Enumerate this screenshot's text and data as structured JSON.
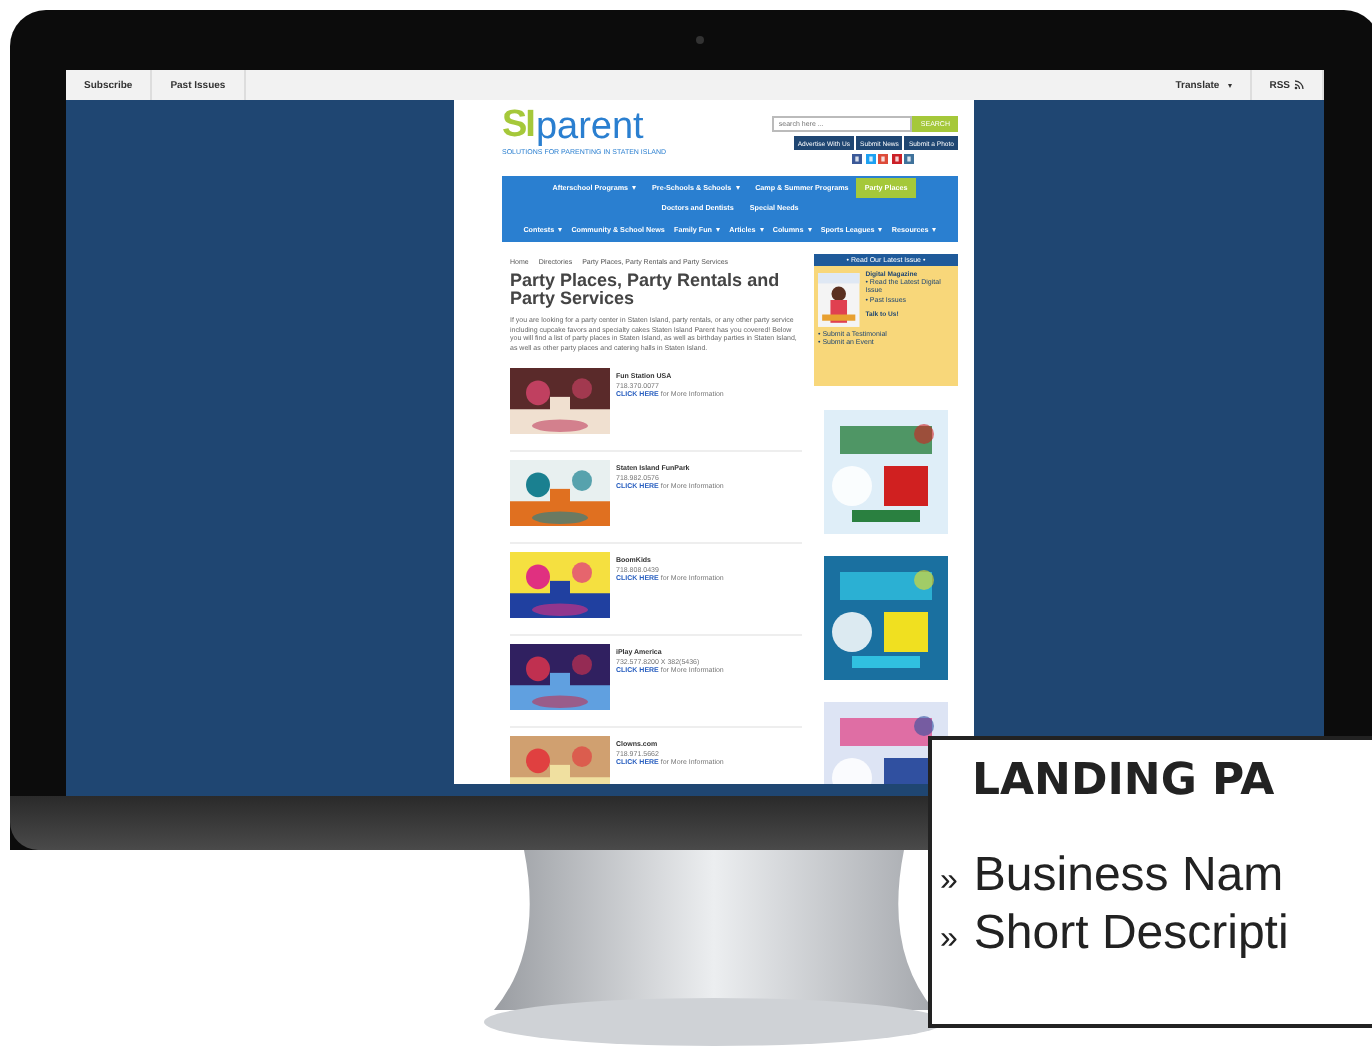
{
  "top_bar": {
    "left_links": [
      "Subscribe",
      "Past Issues"
    ],
    "right_links": [
      {
        "label": "Translate",
        "dropdown": true,
        "icon": false
      },
      {
        "label": "RSS",
        "dropdown": false,
        "icon": true
      }
    ]
  },
  "logo": {
    "mark": "SI",
    "word": "parent",
    "tagline": "SOLUTIONS FOR PARENTING IN STATEN ISLAND"
  },
  "search": {
    "placeholder": "search here ...",
    "button": "SEARCH"
  },
  "header_buttons": [
    "Advertise With Us",
    "Submit News",
    "Submit a Photo"
  ],
  "nav_primary": [
    {
      "label": "Afterschool Programs",
      "dropdown": true,
      "selected": false
    },
    {
      "label": "Pre-Schools & Schools",
      "dropdown": true,
      "selected": false
    },
    {
      "label": "Camp & Summer Programs",
      "dropdown": false,
      "selected": false
    },
    {
      "label": "Party Places",
      "dropdown": false,
      "selected": true
    },
    {
      "label": "Doctors and Dentists",
      "dropdown": false,
      "selected": false
    },
    {
      "label": "Special Needs",
      "dropdown": false,
      "selected": false
    }
  ],
  "nav_secondary": [
    {
      "label": "Contests",
      "dropdown": true
    },
    {
      "label": "Community & School News",
      "dropdown": false
    },
    {
      "label": "Family Fun",
      "dropdown": true
    },
    {
      "label": "Articles",
      "dropdown": true
    },
    {
      "label": "Columns",
      "dropdown": true
    },
    {
      "label": "Sports Leagues",
      "dropdown": true
    },
    {
      "label": "Resources",
      "dropdown": true
    }
  ],
  "breadcrumb": [
    "Home",
    "Directories",
    "Party Places, Party Rentals and Party Services"
  ],
  "title": "Party Places, Party Rentals and Party Services",
  "intro": "If you are looking for a party center in Staten Island, party rentals, or any other party service including cupcake favors and specialty cakes Staten Island Parent has you covered! Below you will find a list of party places in Staten Island, as well as birthday parties in Staten Island, as well as other party places and catering halls in Staten Island.",
  "listings": [
    {
      "name": "Fun Station USA",
      "phone": "718.370.0077",
      "link": "CLICK HERE",
      "suffix": " for More Information"
    },
    {
      "name": "Staten Island FunPark",
      "phone": "718.982.0576",
      "link": "CLICK HERE",
      "suffix": " for More Information"
    },
    {
      "name": "BoomKids",
      "phone": "718.808.0439",
      "link": "CLICK HERE",
      "suffix": " for More Information"
    },
    {
      "name": "iPlay America",
      "phone": "732.577.8200 X 382(5436)",
      "link": "CLICK HERE",
      "suffix": " for More Information"
    },
    {
      "name": "Clowns.com",
      "phone": "718.971.5662",
      "link": "CLICK HERE",
      "suffix": " for More Information"
    }
  ],
  "sidebar": {
    "header": "• Read Our Latest Issue •",
    "magazine_title": "Digital Magazine",
    "magazine_links": [
      "• Read the Latest Digital Issue",
      "• Past Issues"
    ],
    "talk_title": "Talk to Us!",
    "talk_links": [
      "• Submit a Testimonial",
      "• Submit an Event"
    ]
  },
  "callout": {
    "title": "LANDING PA",
    "bullet": "»",
    "items": [
      "Business Nam",
      "Short Descripti"
    ]
  }
}
